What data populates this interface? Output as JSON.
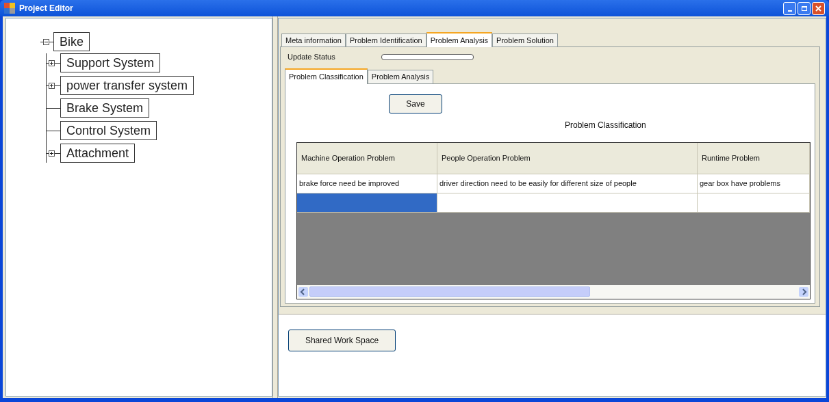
{
  "window": {
    "title": "Project Editor"
  },
  "tree": {
    "label": "Bike",
    "has_children": true,
    "expanded": true,
    "children": [
      {
        "label": "Support System",
        "has_children": true,
        "expanded": false
      },
      {
        "label": "power transfer system",
        "has_children": true,
        "expanded": false
      },
      {
        "label": "Brake System",
        "has_children": false
      },
      {
        "label": "Control System",
        "has_children": false
      },
      {
        "label": "Attachment",
        "has_children": true,
        "expanded": false
      }
    ]
  },
  "tabs": [
    {
      "label": "Meta information",
      "selected": false
    },
    {
      "label": "Problem Identification",
      "selected": false
    },
    {
      "label": "Problem Analysis",
      "selected": true
    },
    {
      "label": "Problem Solution",
      "selected": false
    }
  ],
  "update_status": {
    "label": "Update Status",
    "level": 0
  },
  "inner_tabs": [
    {
      "label": "Problem Classification",
      "selected": true
    },
    {
      "label": "Problem Analysis",
      "selected": false
    }
  ],
  "save_button": "Save",
  "grid_title": "Problem Classification",
  "grid": {
    "columns": [
      "Machine Operation Problem",
      "People Operation Problem",
      "Runtime Problem"
    ],
    "rows": [
      {
        "cells": [
          "brake force need be improved",
          "driver direction need to be easily for different size of people",
          "gear box have problems"
        ]
      }
    ],
    "new_row": [
      {
        "selected": true
      },
      {
        "selected": false
      },
      {
        "selected": false
      }
    ]
  },
  "shared_button": "Shared Work Space"
}
